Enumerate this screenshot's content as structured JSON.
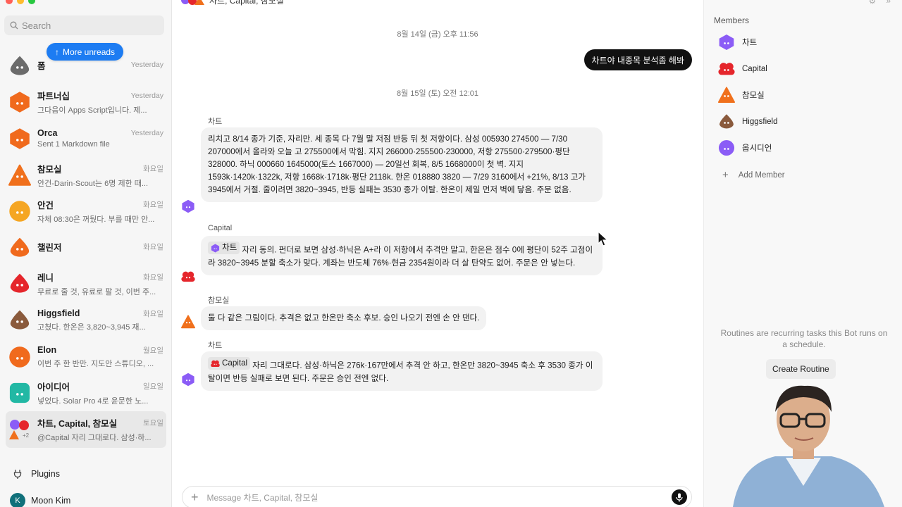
{
  "sidebar": {
    "search_placeholder": "Search",
    "more_unreads": "More unreads",
    "chats": [
      {
        "name": "폼",
        "preview": "",
        "date": "Yesterday",
        "color": "#6b6b6b",
        "shape": "drop"
      },
      {
        "name": "파트너십",
        "preview": "그다음이 Apps Script입니다. 제...",
        "date": "Yesterday",
        "color": "#f06a1d",
        "shape": "hex"
      },
      {
        "name": "Orca",
        "preview": "Sent 1 Markdown file",
        "date": "Yesterday",
        "color": "#f06a1d",
        "shape": "hex"
      },
      {
        "name": "참모실",
        "preview": "안건-Darin·Scout는 6명 제한 때...",
        "date": "화요일",
        "color": "#f0701c",
        "shape": "tri"
      },
      {
        "name": "안건",
        "preview": "자체 08:30은 꺼뒀다. 부를 때만 안...",
        "date": "화요일",
        "color": "#f5a623",
        "shape": "circle"
      },
      {
        "name": "챌린저",
        "preview": "",
        "date": "화요일",
        "color": "#f06a1d",
        "shape": "drop"
      },
      {
        "name": "레니",
        "preview": "무료로 줄 것, 유료로 팔 것, 이번 주...",
        "date": "화요일",
        "color": "#e5262c",
        "shape": "drop"
      },
      {
        "name": "Higgsfield",
        "preview": "고쳤다. 한온은 3,820~3,945 재...",
        "date": "화요일",
        "color": "#8a5a3c",
        "shape": "drop"
      },
      {
        "name": "Elon",
        "preview": "이번 주 한 반만. 지도안 스튜디오, ...",
        "date": "월요일",
        "color": "#f06a1d",
        "shape": "circle"
      },
      {
        "name": "아이디어",
        "preview": "넣었다. Solar Pro 4로 윤문한 노...",
        "date": "일요일",
        "color": "#22b8a4",
        "shape": "square"
      },
      {
        "name": "차트, Capital, 참모실",
        "preview": "@Capital 자리 그대로다. 삼성·하...",
        "date": "토요일",
        "color": "#8b5cf6",
        "shape": "group"
      }
    ],
    "plugins_label": "Plugins",
    "user_initial": "K",
    "user_name": "Moon Kim"
  },
  "main": {
    "header_title": "차트, Capital, 참모실",
    "date1": "8월 14일 (금) 오후 11:56",
    "my_message": "차트야 내종목 분석좀 해봐",
    "date2": "8월 15일 (토) 오전 12:01",
    "messages": [
      {
        "sender": "차트",
        "mention": "",
        "text": "리치고 8/14 종가 기준, 자리만. 세 종목 다 7월 말 저점 반등 뒤 첫 저항이다. 삼성 005930 274500 — 7/30 207000에서 올라와 오늘 고 275500에서 막힘. 지지 266000·255500·230000, 저항 275500·279500·평단 328000. 하닉 000660 1645000(토스 1667000) — 20일선 회복, 8/5 1668000이 첫 벽. 지지 1593k·1420k·1322k, 저항 1668k·1718k·평단 2118k. 한온 018880 3820 — 7/29 3160에서 +21%, 8/13 고가 3945에서 거절. 줄이려면 3820~3945, 반등 실패는 3530 종가 이탈. 한온이 제일 먼저 벽에 닿음. 주문 없음."
      },
      {
        "sender": "Capital",
        "mention": "차트",
        "text": "자리 동의. 펀더로 보면 삼성·하닉은 A+라 이 저항에서 추격만 말고, 한온은 점수 0에 평단이 52주 고점이라 3820~3945 분할 축소가 맞다. 계좌는 반도체 76%·현금 2354원이라 더 살 탄약도 없어. 주문은 안 넣는다."
      },
      {
        "sender": "참모실",
        "mention": "",
        "text": "둘 다 같은 그림이다. 추격은 없고 한온만 축소 후보. 승인 나오기 전엔 손 안 댄다."
      },
      {
        "sender": "차트",
        "mention": "Capital",
        "text": "자리 그대로다. 삼성·하닉은 276k·167만에서 추격 안 하고, 한온만 3820~3945 축소 후 3530 종가 이탈이면 반등 실패로 보면 된다. 주문은 승인 전엔 없다."
      }
    ],
    "composer_placeholder": "Message 차트, Capital, 참모실"
  },
  "right": {
    "members_title": "Members",
    "members": [
      {
        "name": "차트",
        "color": "#8b5cf6",
        "shape": "hex"
      },
      {
        "name": "Capital",
        "color": "#e5262c",
        "shape": "cloud"
      },
      {
        "name": "참모실",
        "color": "#f0701c",
        "shape": "tri"
      },
      {
        "name": "Higgsfield",
        "color": "#8a5a3c",
        "shape": "drop"
      },
      {
        "name": "옵시디언",
        "color": "#8b5cf6",
        "shape": "circle"
      }
    ],
    "add_member": "Add Member",
    "routines_text": "Routines are recurring tasks this Bot runs on a schedule.",
    "create_routine": "Create Routine"
  }
}
